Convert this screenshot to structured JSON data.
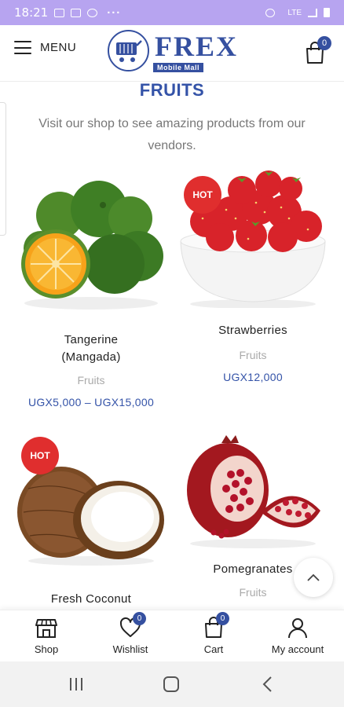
{
  "status_bar": {
    "time": "18:21",
    "dots": "···",
    "network": "LTE"
  },
  "header": {
    "menu_label": "MENU",
    "logo_word": "FREX",
    "logo_tagline": "Mobile Mall",
    "cart_count": "0"
  },
  "page": {
    "title": "FRUITS",
    "description": "Visit our shop to see amazing products from our vendors."
  },
  "products": [
    {
      "name": "Tangerine (Mangada)",
      "category": "Fruits",
      "price": "UGX5,000 – UGX15,000",
      "badge": ""
    },
    {
      "name": "Strawberries",
      "category": "Fruits",
      "price": "UGX12,000",
      "badge": "HOT"
    },
    {
      "name": "Fresh Coconut",
      "category": "",
      "price": "",
      "badge": "HOT"
    },
    {
      "name": "Pomegranates",
      "category": "Fruits",
      "price": "",
      "badge": ""
    }
  ],
  "bottom_nav": [
    {
      "label": "Shop",
      "icon": "store-icon",
      "badge": ""
    },
    {
      "label": "Wishlist",
      "icon": "heart-icon",
      "badge": "0"
    },
    {
      "label": "Cart",
      "icon": "cart-icon",
      "badge": "0"
    },
    {
      "label": "My account",
      "icon": "user-icon",
      "badge": ""
    }
  ],
  "colors": {
    "brand": "#3550a0",
    "price": "#3453a8",
    "hot_badge": "#e02e2e",
    "status_bar": "#b7a4f0"
  }
}
